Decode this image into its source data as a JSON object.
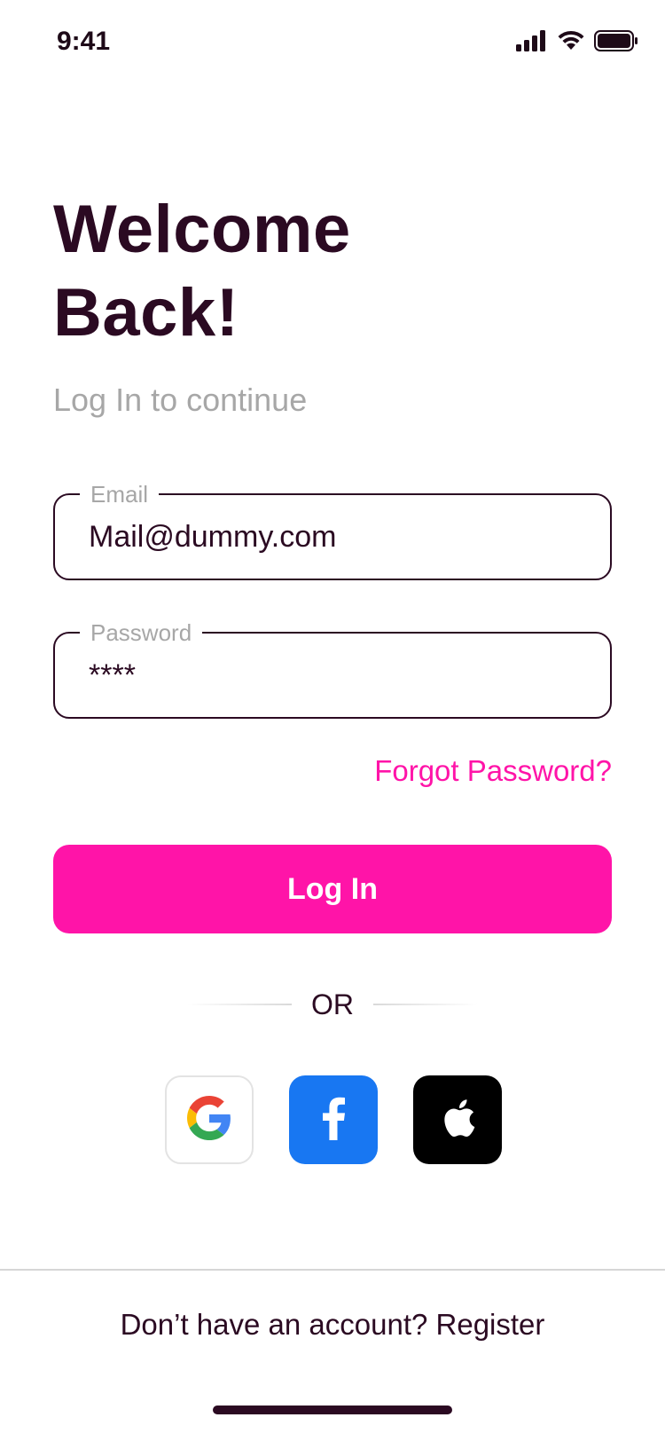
{
  "status_bar": {
    "time": "9:41",
    "icons": [
      "signal-icon",
      "wifi-icon",
      "battery-icon"
    ]
  },
  "header": {
    "title": "Welcome\nBack!",
    "subtitle": "Log In to continue"
  },
  "form": {
    "email": {
      "label": "Email",
      "value": "Mail@dummy.com"
    },
    "password": {
      "label": "Password",
      "value": "****"
    },
    "forgot_label": "Forgot Password?",
    "login_label": "Log In"
  },
  "divider": {
    "or_label": "OR"
  },
  "social": {
    "buttons": [
      {
        "icon": "google-icon"
      },
      {
        "icon": "facebook-icon",
        "color": "#1877f2"
      },
      {
        "icon": "apple-icon",
        "color": "#000000"
      }
    ]
  },
  "footer": {
    "text": "Don’t have an account? Register"
  },
  "colors": {
    "accent": "#ff14a8",
    "text": "#2b0a22",
    "muted": "#a7a7a7",
    "facebook": "#1877f2",
    "apple": "#000000"
  }
}
